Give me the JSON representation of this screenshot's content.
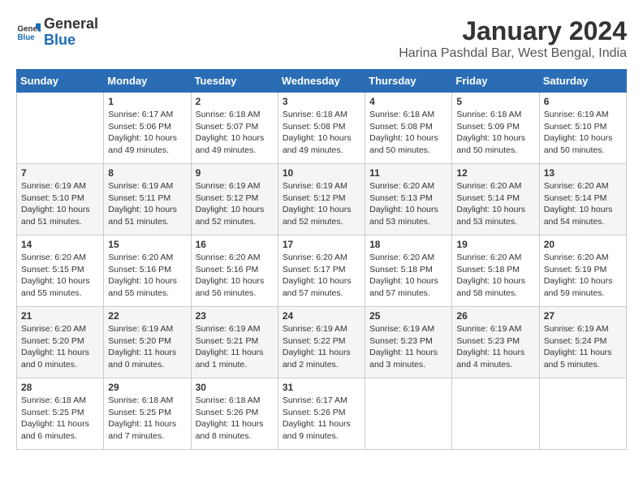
{
  "logo": {
    "general": "General",
    "blue": "Blue"
  },
  "title": "January 2024",
  "subtitle": "Harina Pashdal Bar, West Bengal, India",
  "days": [
    "Sunday",
    "Monday",
    "Tuesday",
    "Wednesday",
    "Thursday",
    "Friday",
    "Saturday"
  ],
  "weeks": [
    [
      {
        "day": "",
        "info": ""
      },
      {
        "day": "1",
        "info": "Sunrise: 6:17 AM\nSunset: 5:06 PM\nDaylight: 10 hours\nand 49 minutes."
      },
      {
        "day": "2",
        "info": "Sunrise: 6:18 AM\nSunset: 5:07 PM\nDaylight: 10 hours\nand 49 minutes."
      },
      {
        "day": "3",
        "info": "Sunrise: 6:18 AM\nSunset: 5:08 PM\nDaylight: 10 hours\nand 49 minutes."
      },
      {
        "day": "4",
        "info": "Sunrise: 6:18 AM\nSunset: 5:08 PM\nDaylight: 10 hours\nand 50 minutes."
      },
      {
        "day": "5",
        "info": "Sunrise: 6:18 AM\nSunset: 5:09 PM\nDaylight: 10 hours\nand 50 minutes."
      },
      {
        "day": "6",
        "info": "Sunrise: 6:19 AM\nSunset: 5:10 PM\nDaylight: 10 hours\nand 50 minutes."
      }
    ],
    [
      {
        "day": "7",
        "info": "Sunrise: 6:19 AM\nSunset: 5:10 PM\nDaylight: 10 hours\nand 51 minutes."
      },
      {
        "day": "8",
        "info": "Sunrise: 6:19 AM\nSunset: 5:11 PM\nDaylight: 10 hours\nand 51 minutes."
      },
      {
        "day": "9",
        "info": "Sunrise: 6:19 AM\nSunset: 5:12 PM\nDaylight: 10 hours\nand 52 minutes."
      },
      {
        "day": "10",
        "info": "Sunrise: 6:19 AM\nSunset: 5:12 PM\nDaylight: 10 hours\nand 52 minutes."
      },
      {
        "day": "11",
        "info": "Sunrise: 6:20 AM\nSunset: 5:13 PM\nDaylight: 10 hours\nand 53 minutes."
      },
      {
        "day": "12",
        "info": "Sunrise: 6:20 AM\nSunset: 5:14 PM\nDaylight: 10 hours\nand 53 minutes."
      },
      {
        "day": "13",
        "info": "Sunrise: 6:20 AM\nSunset: 5:14 PM\nDaylight: 10 hours\nand 54 minutes."
      }
    ],
    [
      {
        "day": "14",
        "info": "Sunrise: 6:20 AM\nSunset: 5:15 PM\nDaylight: 10 hours\nand 55 minutes."
      },
      {
        "day": "15",
        "info": "Sunrise: 6:20 AM\nSunset: 5:16 PM\nDaylight: 10 hours\nand 55 minutes."
      },
      {
        "day": "16",
        "info": "Sunrise: 6:20 AM\nSunset: 5:16 PM\nDaylight: 10 hours\nand 56 minutes."
      },
      {
        "day": "17",
        "info": "Sunrise: 6:20 AM\nSunset: 5:17 PM\nDaylight: 10 hours\nand 57 minutes."
      },
      {
        "day": "18",
        "info": "Sunrise: 6:20 AM\nSunset: 5:18 PM\nDaylight: 10 hours\nand 57 minutes."
      },
      {
        "day": "19",
        "info": "Sunrise: 6:20 AM\nSunset: 5:18 PM\nDaylight: 10 hours\nand 58 minutes."
      },
      {
        "day": "20",
        "info": "Sunrise: 6:20 AM\nSunset: 5:19 PM\nDaylight: 10 hours\nand 59 minutes."
      }
    ],
    [
      {
        "day": "21",
        "info": "Sunrise: 6:20 AM\nSunset: 5:20 PM\nDaylight: 11 hours\nand 0 minutes."
      },
      {
        "day": "22",
        "info": "Sunrise: 6:19 AM\nSunset: 5:20 PM\nDaylight: 11 hours\nand 0 minutes."
      },
      {
        "day": "23",
        "info": "Sunrise: 6:19 AM\nSunset: 5:21 PM\nDaylight: 11 hours\nand 1 minute."
      },
      {
        "day": "24",
        "info": "Sunrise: 6:19 AM\nSunset: 5:22 PM\nDaylight: 11 hours\nand 2 minutes."
      },
      {
        "day": "25",
        "info": "Sunrise: 6:19 AM\nSunset: 5:23 PM\nDaylight: 11 hours\nand 3 minutes."
      },
      {
        "day": "26",
        "info": "Sunrise: 6:19 AM\nSunset: 5:23 PM\nDaylight: 11 hours\nand 4 minutes."
      },
      {
        "day": "27",
        "info": "Sunrise: 6:19 AM\nSunset: 5:24 PM\nDaylight: 11 hours\nand 5 minutes."
      }
    ],
    [
      {
        "day": "28",
        "info": "Sunrise: 6:18 AM\nSunset: 5:25 PM\nDaylight: 11 hours\nand 6 minutes."
      },
      {
        "day": "29",
        "info": "Sunrise: 6:18 AM\nSunset: 5:25 PM\nDaylight: 11 hours\nand 7 minutes."
      },
      {
        "day": "30",
        "info": "Sunrise: 6:18 AM\nSunset: 5:26 PM\nDaylight: 11 hours\nand 8 minutes."
      },
      {
        "day": "31",
        "info": "Sunrise: 6:17 AM\nSunset: 5:26 PM\nDaylight: 11 hours\nand 9 minutes."
      },
      {
        "day": "",
        "info": ""
      },
      {
        "day": "",
        "info": ""
      },
      {
        "day": "",
        "info": ""
      }
    ]
  ]
}
